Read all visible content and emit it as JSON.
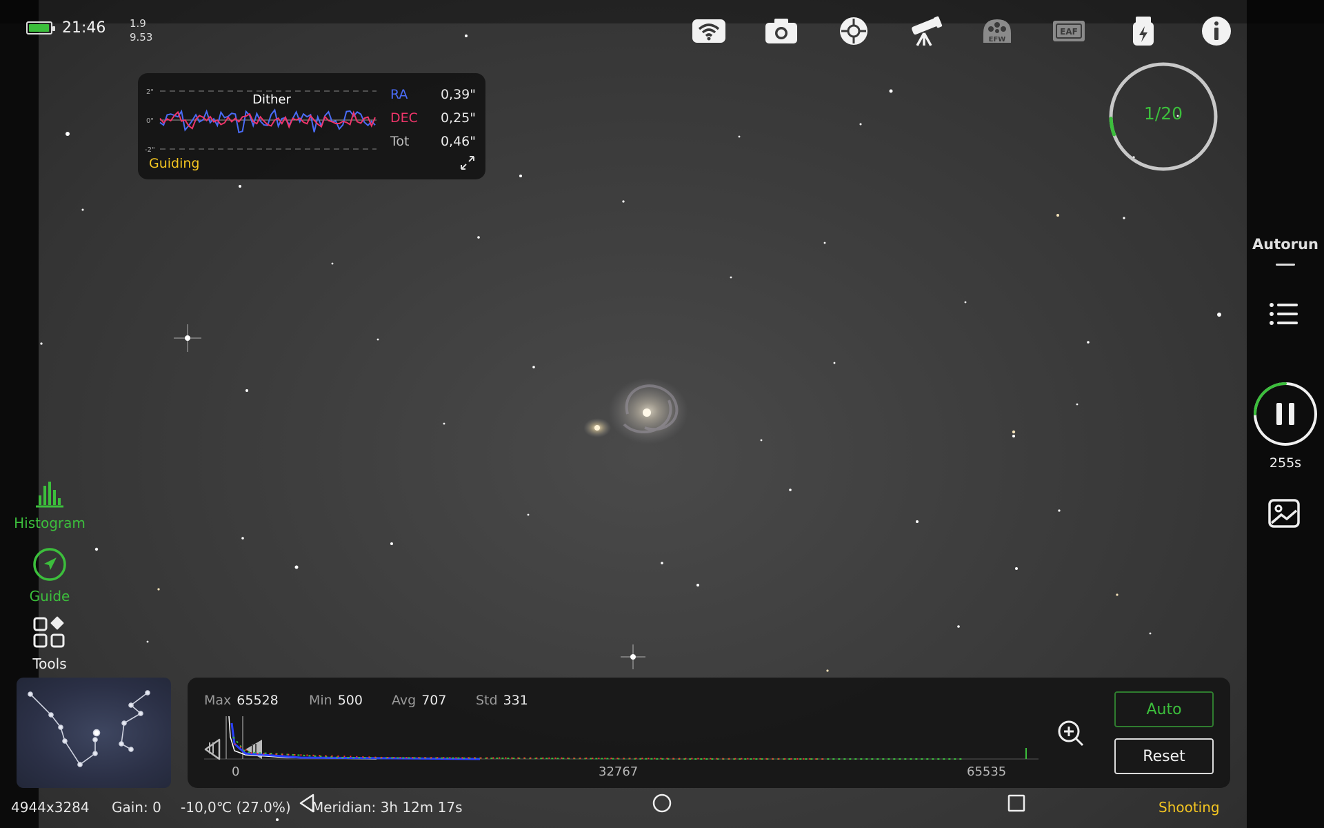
{
  "status_bar": {
    "battery_level": 0.85,
    "time": "21:46",
    "load_line1": "1.9",
    "load_line2": "9.53"
  },
  "top_icons": [
    {
      "name": "wifi-icon"
    },
    {
      "name": "camera-icon"
    },
    {
      "name": "guide-scope-icon"
    },
    {
      "name": "telescope-mount-icon"
    },
    {
      "name": "efw-filter-wheel-icon",
      "label": "EFW"
    },
    {
      "name": "eaf-focuser-icon",
      "label": "EAF"
    },
    {
      "name": "power-dongle-icon"
    },
    {
      "name": "info-icon"
    }
  ],
  "guiding": {
    "title": "Guiding",
    "annotation": "Dither",
    "y_ticks": [
      "2\"",
      "0\"",
      "-2\""
    ],
    "ra_label": "RA",
    "ra_value": "0,39\"",
    "dec_label": "DEC",
    "dec_value": "0,25\"",
    "tot_label": "Tot",
    "tot_value": "0,46\"",
    "ra_color": "#4a6cf7",
    "dec_color": "#f0356a"
  },
  "sequence": {
    "progress_text": "1/20",
    "progress_fraction": 0.05
  },
  "right_panel": {
    "autorun_label": "Autorun",
    "exposure_remaining": "255s",
    "exposure_fraction": 0.25
  },
  "left_panel": {
    "histogram_label": "Histogram",
    "guide_label": "Guide",
    "tools_label": "Tools"
  },
  "histogram": {
    "max_label": "Max",
    "max_value": "65528",
    "min_label": "Min",
    "min_value": "500",
    "avg_label": "Avg",
    "avg_value": "707",
    "std_label": "Std",
    "std_value": "331",
    "tick_0": "0",
    "tick_mid": "32767",
    "tick_max": "65535",
    "auto_label": "Auto",
    "reset_label": "Reset"
  },
  "footer": {
    "resolution": "4944x3284",
    "gain": "Gain: 0",
    "temperature": "-10,0℃  (27.0%)",
    "meridian": "Meridian: 3h 12m 17s",
    "state": "Shooting"
  },
  "colors": {
    "accent_green": "#3cbf3c",
    "accent_yellow": "#f3c521",
    "ra_blue": "#4a6cf7",
    "dec_pink": "#f0356a"
  }
}
